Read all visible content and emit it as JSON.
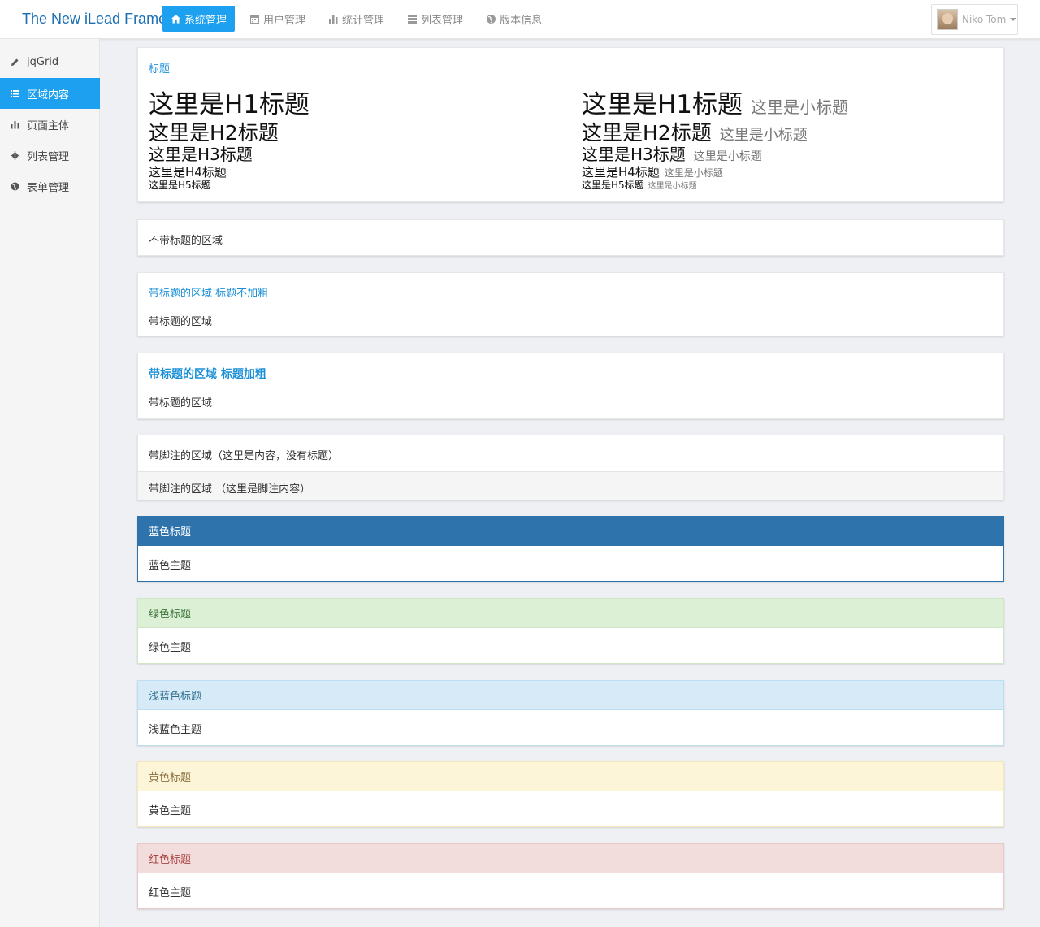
{
  "header": {
    "brand": "The New iLead Frame",
    "nav": [
      {
        "label": "系统管理",
        "icon": "home-icon"
      },
      {
        "label": "用户管理",
        "icon": "calendar-icon"
      },
      {
        "label": "统计管理",
        "icon": "bar-chart-icon"
      },
      {
        "label": "列表管理",
        "icon": "server-icon"
      },
      {
        "label": "版本信息",
        "icon": "globe-icon"
      }
    ],
    "user_name": "Niko Tom"
  },
  "sidebar": {
    "items": [
      {
        "label": "jqGrid",
        "icon": "pencil-icon"
      },
      {
        "label": "区域内容",
        "icon": "list-icon"
      },
      {
        "label": "页面主体",
        "icon": "bar-chart-icon"
      },
      {
        "label": "列表管理",
        "icon": "gear-icon"
      },
      {
        "label": "表单管理",
        "icon": "globe-icon"
      }
    ]
  },
  "headings_panel": {
    "title": "标题",
    "h1": "这里是H1标题",
    "h2": "这里是H2标题",
    "h3": "这里是H3标题",
    "h4": "这里是H4标题",
    "h5": "这里是H5标题",
    "small": "这里是小标题"
  },
  "plain_panel": {
    "text": "不带标题的区域"
  },
  "titled_panel": {
    "title": "带标题的区域 标题不加粗",
    "body": "带标题的区域"
  },
  "bold_titled_panel": {
    "title": "带标题的区域 标题加粗",
    "body": "带标题的区域"
  },
  "footer_panel": {
    "body": "带脚注的区域（这里是内容，没有标题）",
    "footer": "带脚注的区域 （这里是脚注内容）"
  },
  "themes": [
    {
      "title": "蓝色标题",
      "body": "蓝色主题",
      "head_bg": "#2f73ad",
      "head_color": "#ffffff",
      "border": "#2f73ad"
    },
    {
      "title": "绿色标题",
      "body": "绿色主题",
      "head_bg": "#dcf0d5",
      "head_color": "#3c763d",
      "border": "#d0e6c6"
    },
    {
      "title": "浅蓝色标题",
      "body": "浅蓝色主题",
      "head_bg": "#d6eaf8",
      "head_color": "#31708f",
      "border": "#bcdff1"
    },
    {
      "title": "黄色标题",
      "body": "黄色主题",
      "head_bg": "#fcf5d8",
      "head_color": "#8a6d3b",
      "border": "#f3e7c0"
    },
    {
      "title": "红色标题",
      "body": "红色主题",
      "head_bg": "#f2dcdc",
      "head_color": "#a94442",
      "border": "#e7c9c9"
    }
  ]
}
